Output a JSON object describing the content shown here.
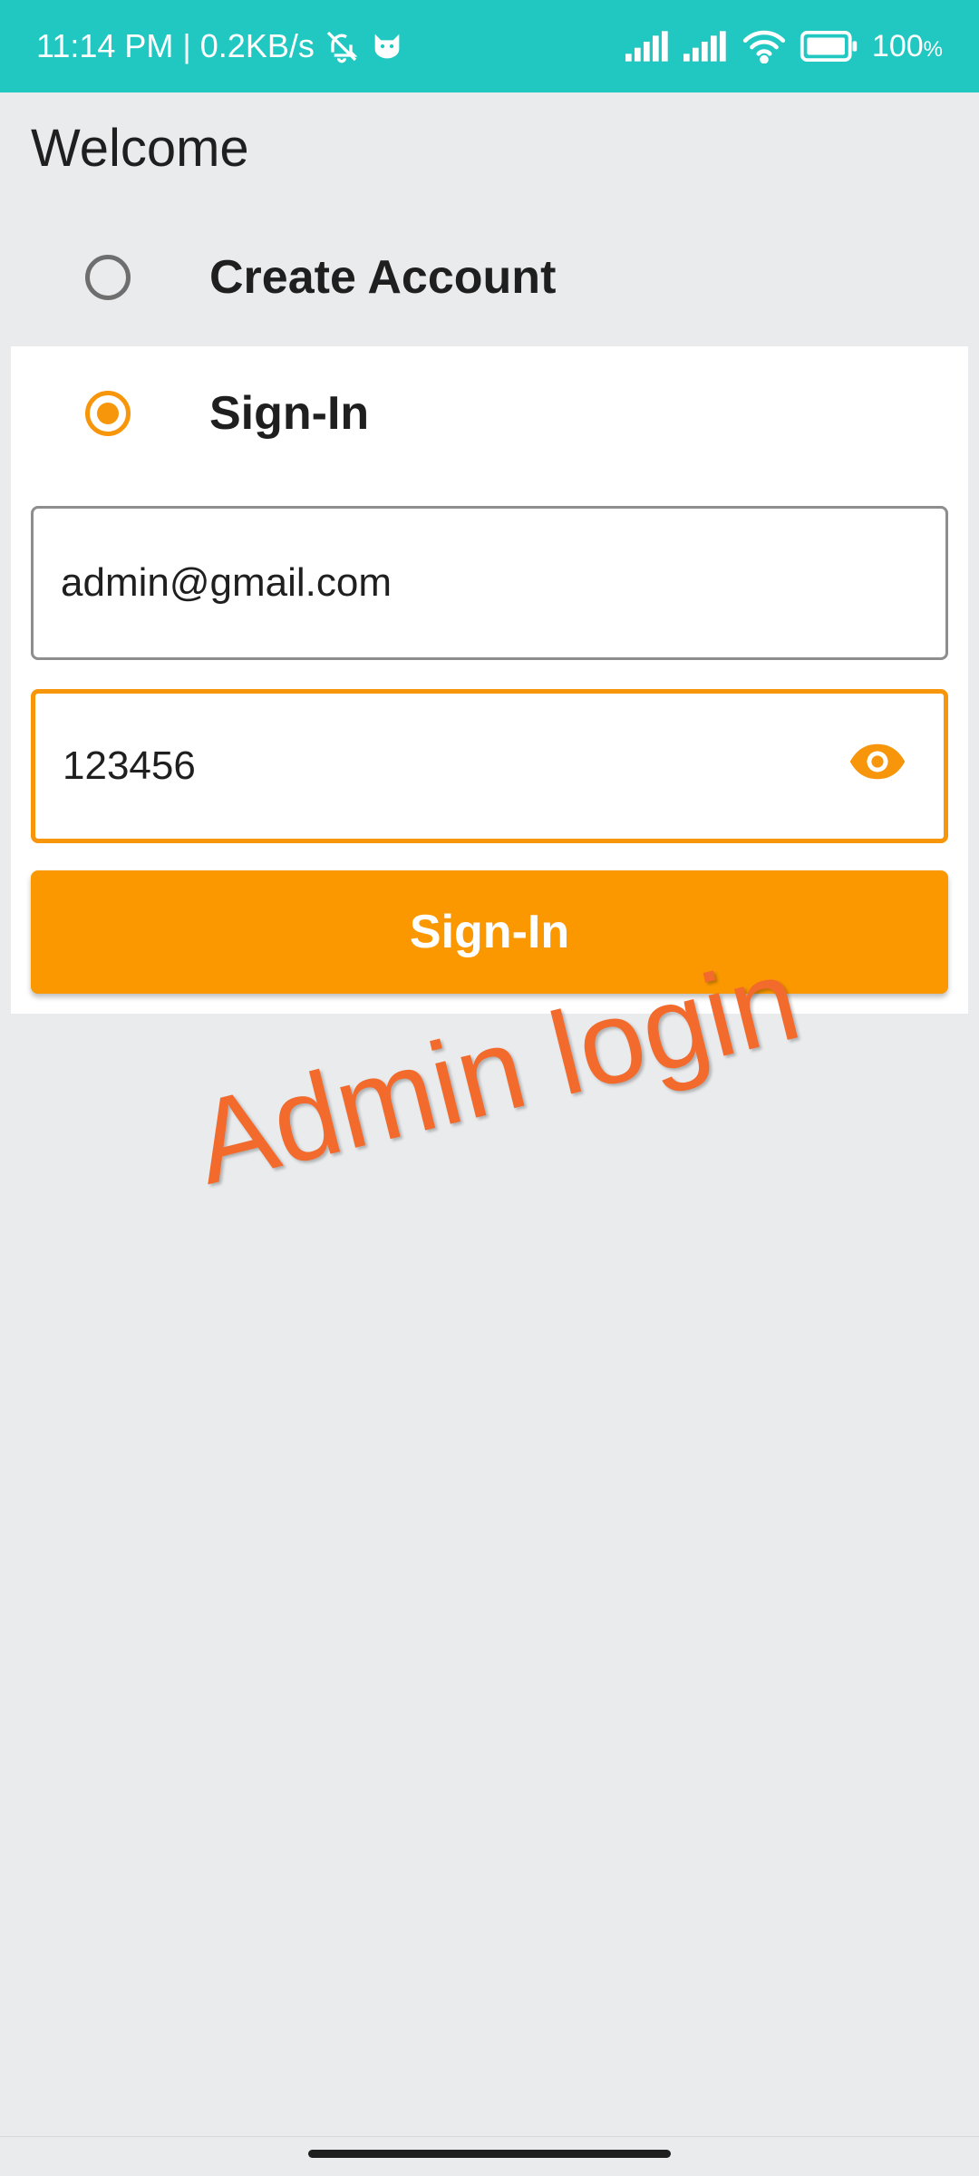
{
  "status_bar": {
    "time_speed": "11:14 PM | 0.2KB/s",
    "battery": "100",
    "icons": [
      "bell-off-icon",
      "cat-icon",
      "signal-icon",
      "signal-icon",
      "wifi-icon",
      "battery-icon"
    ]
  },
  "page": {
    "title": "Welcome"
  },
  "options": {
    "create_label": "Create Account",
    "signin_label": "Sign-In",
    "selected": "Sign-In"
  },
  "form": {
    "email_value": "admin@gmail.com",
    "password_value": "123456",
    "submit_label": "Sign-In"
  },
  "annotation": {
    "text": "Admin login"
  },
  "colors": {
    "status_bar": "#21c8c2",
    "accent": "#f7950b",
    "button": "#fb9800",
    "annotation": "#f26a2c",
    "background": "#eaebed"
  }
}
